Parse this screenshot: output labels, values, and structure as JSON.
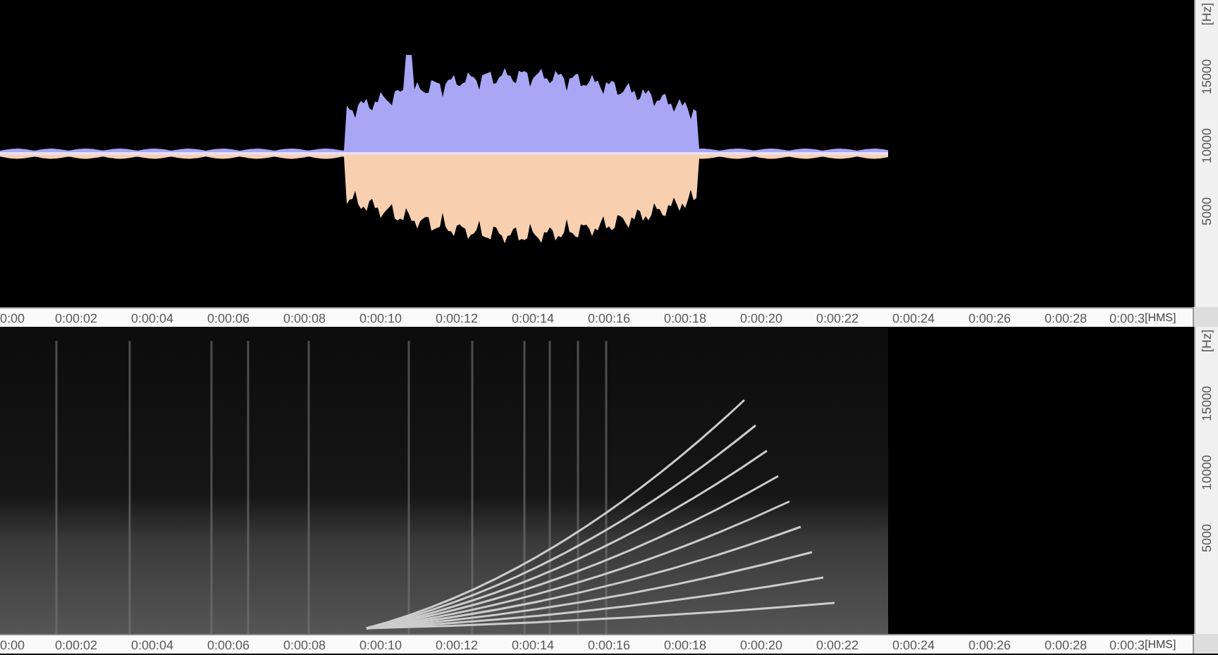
{
  "waveform_panel": {
    "frequency_axis": {
      "unit": "[Hz]",
      "labels": [
        "15000",
        "10000",
        "5000"
      ]
    },
    "time_axis": {
      "labels": [
        "0:00",
        "0:00:02",
        "0:00:04",
        "0:00:06",
        "0:00:08",
        "0:00:10",
        "0:00:12",
        "0:00:14",
        "0:00:16",
        "0:00:18",
        "0:00:20",
        "0:00:22",
        "0:00:24",
        "0:00:26",
        "0:00:28",
        "0:00:3"
      ],
      "unit": "[HMS]"
    }
  },
  "spectrogram_panel": {
    "frequency_axis": {
      "unit": "[Hz]",
      "labels": [
        "15000",
        "10000",
        "5000"
      ]
    },
    "time_axis": {
      "labels": [
        "0:00",
        "0:00:02",
        "0:00:04",
        "0:00:06",
        "0:00:08",
        "0:00:10",
        "0:00:12",
        "0:00:14",
        "0:00:16",
        "0:00:18",
        "0:00:20",
        "0:00:22",
        "0:00:24",
        "0:00:26",
        "0:00:28",
        "0:00:3"
      ],
      "unit": "[HMS]"
    }
  }
}
